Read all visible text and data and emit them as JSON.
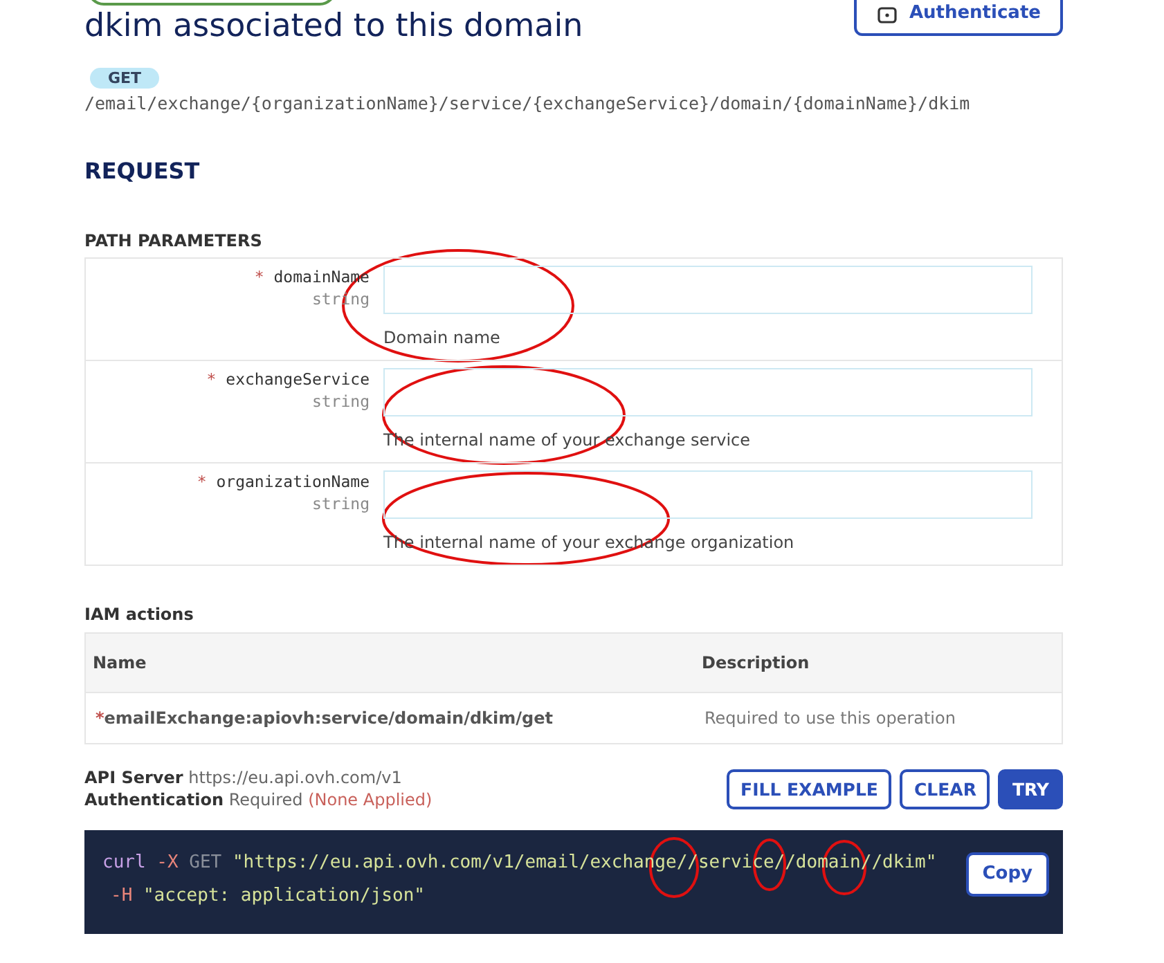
{
  "auth_button": {
    "label": "Authenticate"
  },
  "title": "dkim associated to this domain",
  "method": "GET",
  "path": "/email/exchange/{organizationName}/service/{exchangeService}/domain/{domainName}/dkim",
  "request_heading": "REQUEST",
  "path_parameters": {
    "heading": "PATH PARAMETERS",
    "params": [
      {
        "required_mark": "*",
        "name": "domainName",
        "type": "string",
        "description": "Domain name"
      },
      {
        "required_mark": "*",
        "name": "exchangeService",
        "type": "string",
        "description": "The internal name of your exchange service"
      },
      {
        "required_mark": "*",
        "name": "organizationName",
        "type": "string",
        "description": "The internal name of your exchange organization"
      }
    ]
  },
  "iam": {
    "heading": "IAM actions",
    "columns": [
      "Name",
      "Description"
    ],
    "rows": [
      {
        "required_mark": "*",
        "name": "emailExchange:apiovh:service/domain/dkim/get",
        "description": "Required to use this operation"
      }
    ]
  },
  "server": {
    "label": "API Server",
    "value": "https://eu.api.ovh.com/v1"
  },
  "authentication": {
    "label": "Authentication",
    "value": "Required",
    "status": "(None Applied)"
  },
  "buttons": [
    {
      "label": "FILL EXAMPLE",
      "kind": "outline"
    },
    {
      "label": "CLEAR",
      "kind": "outline"
    },
    {
      "label": "TRY",
      "kind": "solid"
    }
  ],
  "code": {
    "lines": [
      [
        {
          "kind": "command",
          "text": "curl"
        },
        {
          "kind": "flag",
          "text": "-X"
        },
        {
          "kind": "method",
          "text": "GET"
        },
        {
          "kind": "string",
          "text": "\"https://eu.api.ovh.com/v1/email/exchange//service//domain//dkim\""
        }
      ],
      [
        {
          "kind": "flag",
          "text": "-H"
        },
        {
          "kind": "string",
          "text": "\"accept: application/json\""
        }
      ]
    ],
    "copy_label": "Copy"
  }
}
